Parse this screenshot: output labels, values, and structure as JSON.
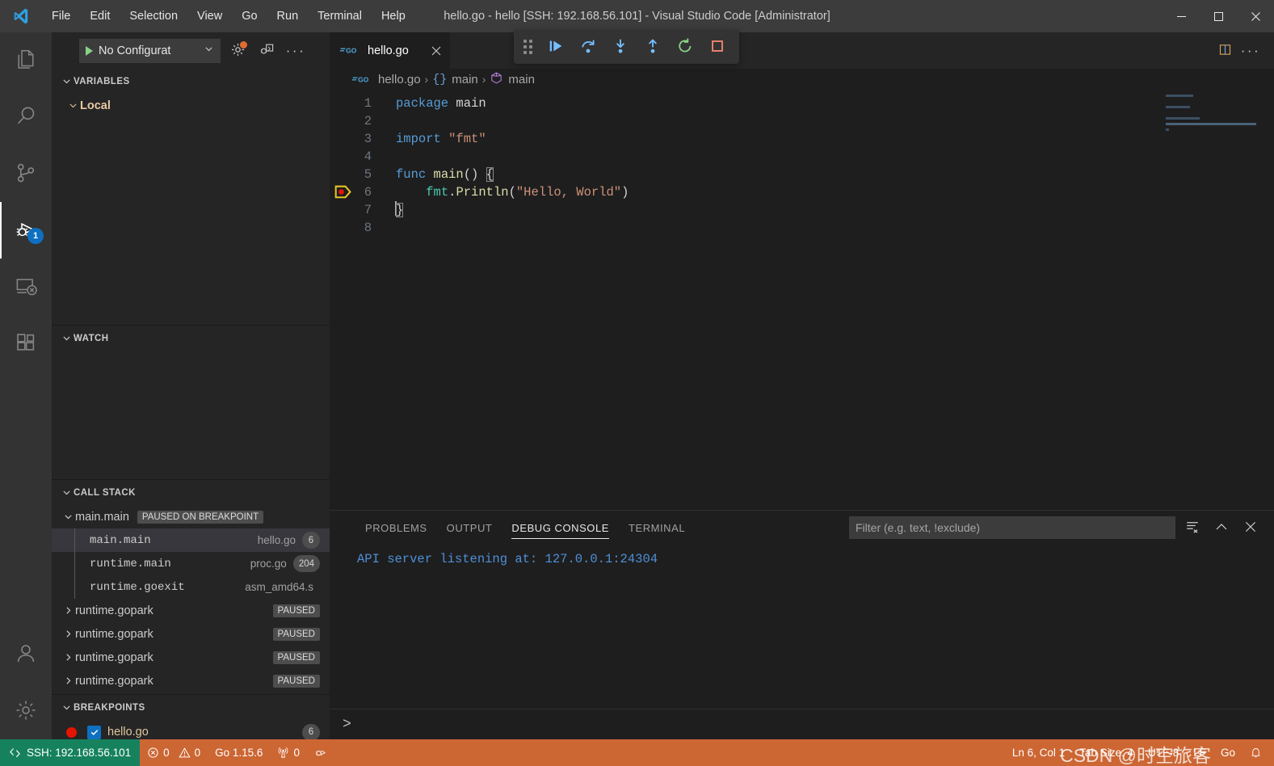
{
  "window": {
    "title": "hello.go - hello [SSH: 192.168.56.101] - Visual Studio Code [Administrator]",
    "logo_icon": "vscode-logo",
    "controls": [
      {
        "name": "minimize-button",
        "icon": "minimize-icon"
      },
      {
        "name": "maximize-button",
        "icon": "maximize-icon"
      },
      {
        "name": "close-button",
        "icon": "close-icon"
      }
    ]
  },
  "menu": [
    {
      "label": "File"
    },
    {
      "label": "Edit"
    },
    {
      "label": "Selection"
    },
    {
      "label": "View"
    },
    {
      "label": "Go"
    },
    {
      "label": "Run"
    },
    {
      "label": "Terminal"
    },
    {
      "label": "Help"
    }
  ],
  "activitybar": {
    "items": [
      {
        "name": "explorer",
        "icon": "files-icon",
        "active": false
      },
      {
        "name": "search",
        "icon": "search-icon",
        "active": false
      },
      {
        "name": "source-control",
        "icon": "source-control-icon",
        "active": false
      },
      {
        "name": "run-and-debug",
        "icon": "debug-icon",
        "active": true,
        "badge": "1"
      },
      {
        "name": "remote-explorer",
        "icon": "remote-explorer-icon",
        "active": false
      },
      {
        "name": "extensions",
        "icon": "extensions-icon",
        "active": false
      }
    ],
    "bottom": [
      {
        "name": "accounts",
        "icon": "account-icon"
      },
      {
        "name": "manage",
        "icon": "gear-icon"
      }
    ]
  },
  "debug_launch": {
    "config_label": "No Configurat",
    "play_icon": "play-icon",
    "dropdown_icon": "chevron-down-icon",
    "gear_icon": "gear-icon",
    "gear_badge_color": "#e06c2f",
    "debug_console_icon": "open-debug-console-icon",
    "more_icon": "more-actions-icon",
    "more_label": "···"
  },
  "debug_toolbar": {
    "buttons": [
      {
        "name": "drag-handle",
        "icon": "grip-icon",
        "tooltip": "Drag"
      },
      {
        "name": "continue-button",
        "icon": "continue-icon",
        "color": "#75beff"
      },
      {
        "name": "step-over-button",
        "icon": "step-over-icon",
        "color": "#75beff"
      },
      {
        "name": "step-into-button",
        "icon": "step-into-icon",
        "color": "#75beff"
      },
      {
        "name": "step-out-button",
        "icon": "step-out-icon",
        "color": "#75beff"
      },
      {
        "name": "restart-button",
        "icon": "restart-icon",
        "color": "#89d185"
      },
      {
        "name": "stop-button",
        "icon": "stop-icon",
        "color": "#f48771"
      }
    ]
  },
  "sidebar": {
    "variables": {
      "title": "VARIABLES",
      "scopes": [
        {
          "label": "Local",
          "expanded": true
        }
      ]
    },
    "watch": {
      "title": "WATCH",
      "items": []
    },
    "callstack": {
      "title": "CALL STACK",
      "threads": [
        {
          "name": "main.main",
          "tag": "PAUSED ON BREAKPOINT",
          "expanded": true,
          "frames": [
            {
              "name": "main.main",
              "file": "hello.go",
              "line": "6",
              "selected": true
            },
            {
              "name": "runtime.main",
              "file": "proc.go",
              "line": "204",
              "selected": false
            },
            {
              "name": "runtime.goexit",
              "file": "asm_amd64.s",
              "line": "",
              "selected": false
            }
          ]
        },
        {
          "name": "runtime.gopark",
          "tag": "PAUSED",
          "expanded": false,
          "frames": []
        },
        {
          "name": "runtime.gopark",
          "tag": "PAUSED",
          "expanded": false,
          "frames": []
        },
        {
          "name": "runtime.gopark",
          "tag": "PAUSED",
          "expanded": false,
          "frames": []
        },
        {
          "name": "runtime.gopark",
          "tag": "PAUSED",
          "expanded": false,
          "frames": []
        }
      ]
    },
    "breakpoints": {
      "title": "BREAKPOINTS",
      "items": [
        {
          "file": "hello.go",
          "line": "6",
          "enabled": true,
          "dot_color": "#e51400"
        }
      ]
    }
  },
  "editor": {
    "tab": {
      "label": "hello.go",
      "icon": "go-file-icon",
      "close_icon": "close-icon",
      "active": true
    },
    "actions": [
      {
        "name": "split-editor-button",
        "icon": "split-editor-icon"
      },
      {
        "name": "editor-more-actions-button",
        "icon": "more-actions-icon",
        "label": "···"
      }
    ],
    "breadcrumb": [
      {
        "label": "hello.go",
        "icon": "go-file-icon"
      },
      {
        "label": "main",
        "icon": "braces-icon"
      },
      {
        "label": "main",
        "icon": "symbol-method-icon"
      }
    ],
    "cursor_line": 6,
    "current_execution_line": 6,
    "breakpoint_lines": [
      6
    ],
    "lines": [
      {
        "n": "1",
        "tokens": [
          {
            "t": "package ",
            "c": "kw"
          },
          {
            "t": "main",
            "c": "plain"
          }
        ]
      },
      {
        "n": "2",
        "tokens": []
      },
      {
        "n": "3",
        "tokens": [
          {
            "t": "import ",
            "c": "kw"
          },
          {
            "t": "\"fmt\"",
            "c": "str"
          }
        ]
      },
      {
        "n": "4",
        "tokens": []
      },
      {
        "n": "5",
        "tokens": [
          {
            "t": "func ",
            "c": "kw"
          },
          {
            "t": "main",
            "c": "fn"
          },
          {
            "t": "() ",
            "c": "plain"
          },
          {
            "t": "{",
            "c": "plain"
          }
        ]
      },
      {
        "n": "6",
        "tokens": [
          {
            "t": "    fmt",
            "c": "pkg"
          },
          {
            "t": ".",
            "c": "plain"
          },
          {
            "t": "Println",
            "c": "fn"
          },
          {
            "t": "(",
            "c": "plain"
          },
          {
            "t": "\"Hello, World\"",
            "c": "str"
          },
          {
            "t": ")",
            "c": "plain"
          }
        ]
      },
      {
        "n": "7",
        "tokens": [
          {
            "t": "}",
            "c": "plain"
          }
        ]
      },
      {
        "n": "8",
        "tokens": []
      }
    ]
  },
  "panel": {
    "tabs": [
      {
        "label": "PROBLEMS",
        "active": false
      },
      {
        "label": "OUTPUT",
        "active": false
      },
      {
        "label": "DEBUG CONSOLE",
        "active": true
      },
      {
        "label": "TERMINAL",
        "active": false
      }
    ],
    "filter": {
      "placeholder": "Filter (e.g. text, !exclude)",
      "value": ""
    },
    "actions": [
      {
        "name": "clear-console-button",
        "icon": "clear-all-icon"
      },
      {
        "name": "maximize-panel-button",
        "icon": "chevron-up-icon"
      },
      {
        "name": "close-panel-button",
        "icon": "close-icon"
      }
    ],
    "console_lines": [
      "API server listening at: 127.0.0.1:24304"
    ],
    "repl_prompt": ">"
  },
  "statusbar": {
    "remote": {
      "label": "SSH: 192.168.56.101",
      "icon": "remote-icon",
      "color": "#16825d"
    },
    "background": "#cc6633",
    "left": [
      {
        "name": "problems",
        "icon": "error-icon",
        "errors": "0",
        "warning_icon": "warning-icon",
        "warnings": "0"
      },
      {
        "name": "go-version",
        "label": "Go 1.15.6"
      },
      {
        "name": "go-telemetry",
        "icon": "radio-tower-icon",
        "label": "0"
      },
      {
        "name": "launch-test",
        "icon": "debug-alt-icon",
        "label": ""
      }
    ],
    "right": [
      {
        "name": "editor-position",
        "label": "Ln 6, Col 1"
      },
      {
        "name": "editor-indentation",
        "label": "Tab Size: 4"
      },
      {
        "name": "editor-encoding",
        "label": "UTF-8"
      },
      {
        "name": "editor-eol",
        "label": "LF"
      },
      {
        "name": "editor-language",
        "label": "Go"
      },
      {
        "name": "notifications",
        "icon": "bell-icon",
        "label": ""
      }
    ]
  },
  "watermark": {
    "text": "CSDN @时空旅客"
  }
}
